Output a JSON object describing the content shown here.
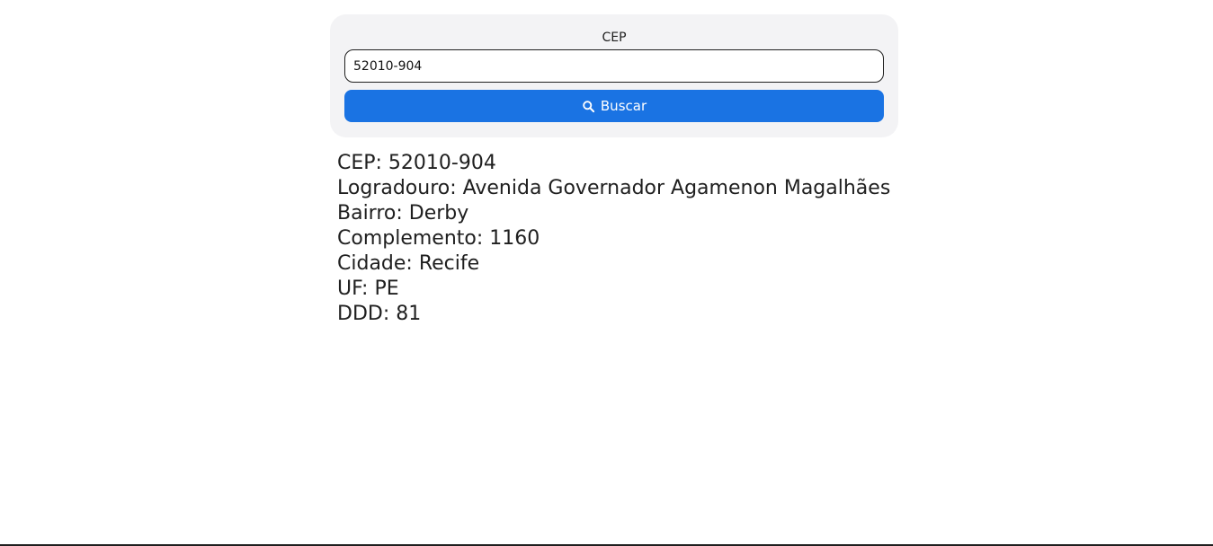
{
  "search": {
    "label": "CEP",
    "value": "52010-904",
    "button_label": "Buscar",
    "button_icon": "search-icon",
    "button_color": "#1a73e3"
  },
  "results": [
    {
      "label": "CEP",
      "value": "52010-904",
      "text": "CEP: 52010-904"
    },
    {
      "label": "Logradouro",
      "value": "Avenida Governador Agamenon Magalhães",
      "text": "Logradouro: Avenida Governador Agamenon Magalhães"
    },
    {
      "label": "Bairro",
      "value": "Derby",
      "text": "Bairro: Derby"
    },
    {
      "label": "Complemento",
      "value": "1160",
      "text": "Complemento: 1160"
    },
    {
      "label": "Cidade",
      "value": "Recife",
      "text": "Cidade: Recife"
    },
    {
      "label": "UF",
      "value": "PE",
      "text": "UF: PE"
    },
    {
      "label": "DDD",
      "value": "81",
      "text": "DDD: 81"
    }
  ]
}
